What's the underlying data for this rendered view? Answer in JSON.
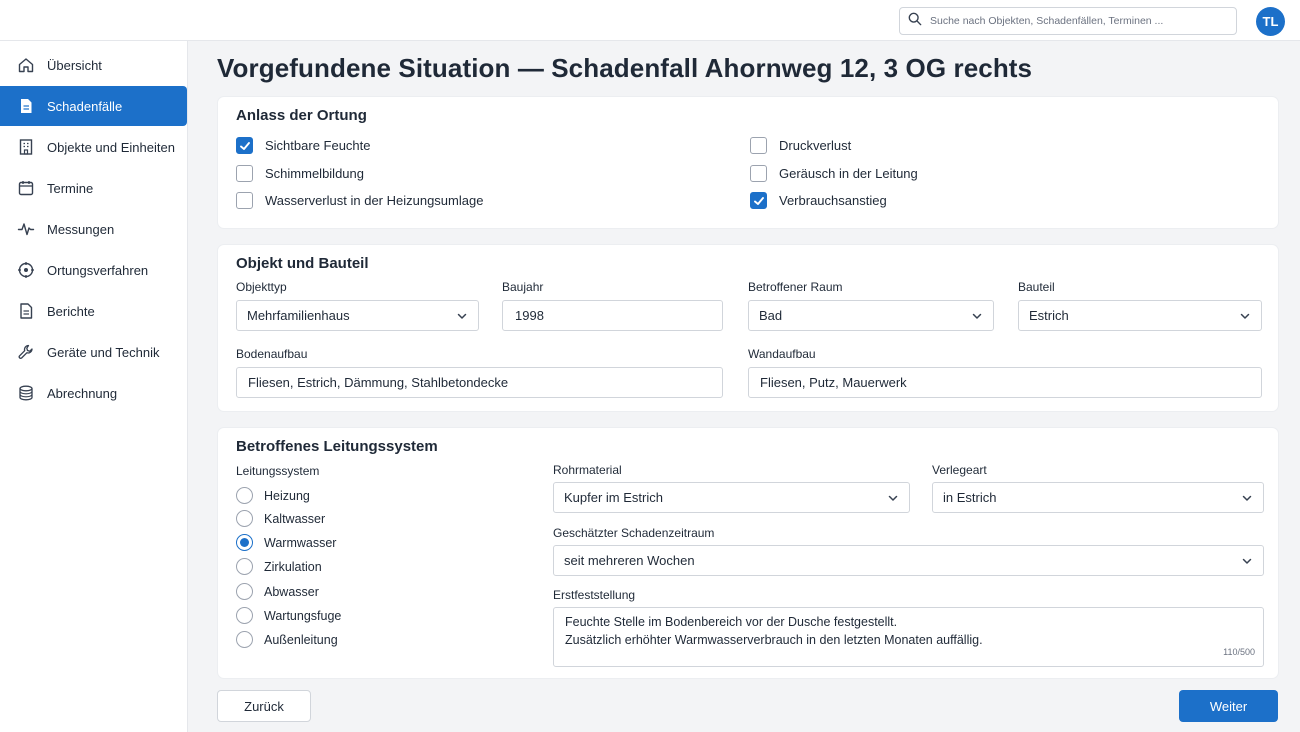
{
  "header": {
    "search_placeholder": "Suche nach Objekten, Schadenfällen, Terminen ...",
    "avatar_initials": "TL"
  },
  "sidebar": {
    "items": [
      {
        "label": "Übersicht",
        "icon": "home-icon"
      },
      {
        "label": "Schadenfälle",
        "icon": "document-icon",
        "active": true
      },
      {
        "label": "Objekte und Einheiten",
        "icon": "building-icon"
      },
      {
        "label": "Termine",
        "icon": "calendar-icon"
      },
      {
        "label": "Messungen",
        "icon": "pulse-icon"
      },
      {
        "label": "Ortungsverfahren",
        "icon": "locate-icon"
      },
      {
        "label": "Berichte",
        "icon": "report-icon"
      },
      {
        "label": "Geräte und Technik",
        "icon": "wrench-icon"
      },
      {
        "label": "Abrechnung",
        "icon": "coins-icon"
      }
    ]
  },
  "page": {
    "title": "Vorgefundene Situation — Schadenfall Ahornweg 12, 3 OG rechts"
  },
  "anlass": {
    "title": "Anlass der Ortung",
    "options": [
      {
        "label": "Sichtbare Feuchte",
        "checked": true
      },
      {
        "label": "Schimmelbildung",
        "checked": false
      },
      {
        "label": "Wasserverlust in der Heizungsumlage",
        "checked": false
      },
      {
        "label": "Druckverlust",
        "checked": false
      },
      {
        "label": "Geräusch in der Leitung",
        "checked": false
      },
      {
        "label": "Verbrauchsanstieg",
        "checked": true
      }
    ]
  },
  "objekt": {
    "title": "Objekt und Bauteil",
    "objekttyp_label": "Objekttyp",
    "objekttyp_value": "Mehrfamilienhaus",
    "baujahr_label": "Baujahr",
    "baujahr_value": "1998",
    "raum_label": "Betroffener Raum",
    "raum_value": "Bad",
    "bauteil_label": "Bauteil",
    "bauteil_value": "Estrich",
    "boden_label": "Bodenaufbau",
    "boden_value": "Fliesen, Estrich, Dämmung, Stahlbetondecke",
    "wand_label": "Wandaufbau",
    "wand_value": "Fliesen, Putz, Mauerwerk"
  },
  "leitung": {
    "title": "Betroffenes Leitungssystem",
    "system_label": "Leitungssystem",
    "systems": [
      {
        "label": "Heizung",
        "checked": false
      },
      {
        "label": "Kaltwasser",
        "checked": false
      },
      {
        "label": "Warmwasser",
        "checked": true
      },
      {
        "label": "Zirkulation",
        "checked": false
      },
      {
        "label": "Abwasser",
        "checked": false
      },
      {
        "label": "Wartungsfuge",
        "checked": false
      },
      {
        "label": "Außenleitung",
        "checked": false
      }
    ],
    "rohr_label": "Rohrmaterial",
    "rohr_value": "Kupfer im Estrich",
    "verlege_label": "Verlegeart",
    "verlege_value": "in Estrich",
    "zeitraum_label": "Geschätzter Schadenzeitraum",
    "zeitraum_value": "seit mehreren Wochen",
    "erst_label": "Erstfeststellung",
    "erst_line1": "Feuchte Stelle im Bodenbereich vor der Dusche festgestellt.",
    "erst_line2": "Zusätzlich erhöhter Warmwasserverbrauch in den letzten Monaten auffällig.",
    "erst_counter": "110/500"
  },
  "actions": {
    "back_label": "Zurück",
    "next_label": "Weiter"
  },
  "colors": {
    "accent": "#1c70c9",
    "background": "#f3f4f6"
  }
}
